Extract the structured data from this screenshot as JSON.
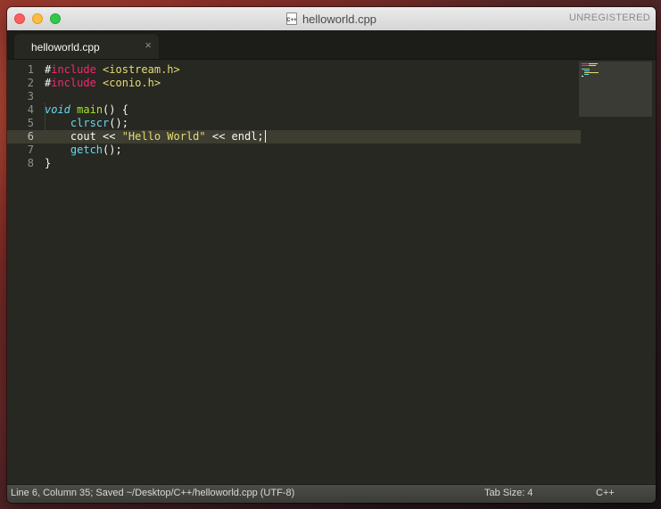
{
  "window": {
    "title": "helloworld.cpp",
    "registration": "UNREGISTERED",
    "file_icon_text": "C++"
  },
  "tabs": [
    {
      "label": "helloworld.cpp",
      "close": "×"
    }
  ],
  "editor": {
    "line_numbers": [
      "1",
      "2",
      "3",
      "4",
      "5",
      "6",
      "7",
      "8"
    ],
    "active_line": 6,
    "lines": {
      "l1": {
        "hash": "#",
        "directive": "include",
        "space": " ",
        "header": "<iostream.h>"
      },
      "l2": {
        "hash": "#",
        "directive": "include",
        "space": " ",
        "header": "<conio.h>"
      },
      "l4": {
        "type": "void",
        "space": " ",
        "name": "main",
        "rest": "() {"
      },
      "l5": {
        "indent": "    ",
        "call": "clrscr",
        "rest": "();"
      },
      "l6": {
        "indent": "    ",
        "pre": "cout << ",
        "string": "\"Hello World\"",
        "post": " << endl;"
      },
      "l7": {
        "indent": "    ",
        "call": "getch",
        "rest": "();"
      },
      "l8": {
        "text": "}"
      }
    }
  },
  "status": {
    "position": "Line 6, Column 35; Saved ~/Desktop/C++/helloworld.cpp (UTF-8)",
    "tab_size": "Tab Size: 4",
    "syntax": "C++"
  },
  "colors": {
    "background": "#272822",
    "foreground": "#f8f8f2",
    "keyword": "#f92672",
    "string": "#e6db74",
    "function": "#a6e22e",
    "type": "#66d9ef",
    "active_line": "#3e3d32"
  }
}
